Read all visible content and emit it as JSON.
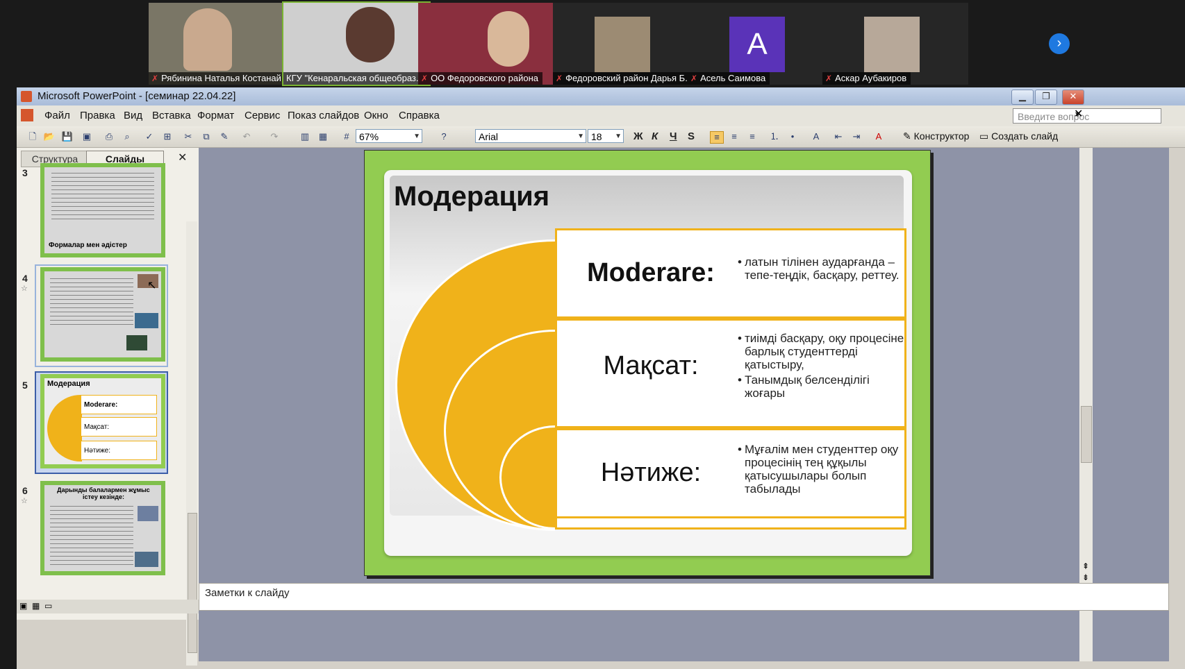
{
  "participants": [
    {
      "name": "Рябинина Наталья Костанай ..."
    },
    {
      "name": "КГУ \"Кенаральская общеобраз..."
    },
    {
      "name": "ОО Федоровского района"
    },
    {
      "name": "Федоровский район Дарья Б..."
    },
    {
      "name": "Асель Саимова",
      "avatar_letter": "A"
    },
    {
      "name": "Аскар Аубакиров"
    }
  ],
  "window": {
    "title": "Microsoft PowerPoint - [семинар 22.04.22]"
  },
  "menu": [
    "Файл",
    "Правка",
    "Вид",
    "Вставка",
    "Формат",
    "Сервис",
    "Показ слайдов",
    "Окно",
    "Справка"
  ],
  "ask_placeholder": "Введите вопрос",
  "toolbar": {
    "zoom": "67%",
    "font": "Arial",
    "size": "18",
    "bold": "Ж",
    "italic": "К",
    "underline": "Ч",
    "shadow": "S",
    "designer": "Конструктор",
    "new_slide": "Создать слайд"
  },
  "panel": {
    "tab_outline": "Структура",
    "tab_slides": "Слайды"
  },
  "thumbs": [
    {
      "num": "3",
      "caption": "Формалар мен әдістер"
    },
    {
      "num": "4",
      "caption": ""
    },
    {
      "num": "5",
      "caption": "Модерация"
    },
    {
      "num": "6",
      "caption": "Дарынды балалармен жұмыс істеу кезінде:"
    }
  ],
  "slide": {
    "title": "Модерация",
    "rows": [
      {
        "label": "Moderare:",
        "bullets": [
          "латын тілінен аударғанда – тепе-теңдік, басқару, реттеу."
        ]
      },
      {
        "label": "Мақсат:",
        "bullets": [
          "тиімді басқару, оқу процесіне барлық студенттерді қатыстыру,",
          "Танымдық белсенділігі жоғары"
        ]
      },
      {
        "label": "Нәтиже:",
        "bullets": [
          "Мұғалім мен студенттер оқу процесінің тең құқылы қатысушылары болып табылады"
        ]
      }
    ]
  },
  "notes_label": "Заметки к слайду",
  "colors": {
    "slide_bg": "#92cc51",
    "accent": "#f0b21a"
  }
}
